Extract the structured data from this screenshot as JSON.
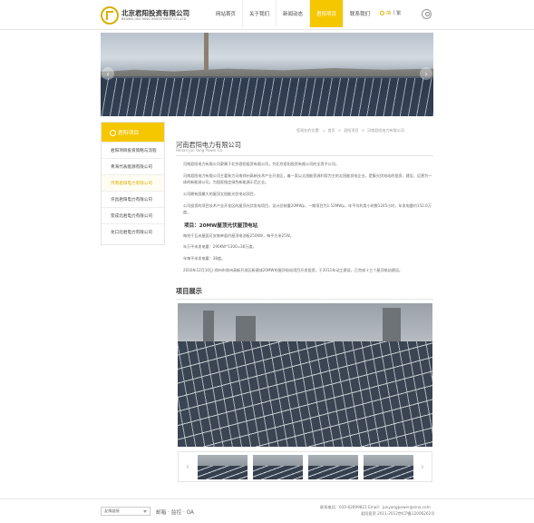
{
  "header": {
    "logo_cn": "北京君阳投资有限公司",
    "logo_en": "BEIJING JUN YANG INVESTMENT CO.,LTD",
    "nav": [
      "网站首页",
      "关于我们",
      "新闻动态",
      "君阳项目",
      "联系我们"
    ],
    "active_nav": "君阳项目",
    "lang_cn": "简",
    "lang_sep": "|",
    "lang_en": "繁",
    "accent_color": "#f5c700"
  },
  "sidebar": {
    "title": "君阳项目",
    "items": [
      "君阳项目投资策略与流程",
      "青海代表能源有限公司",
      "河南君阳电力有限公司",
      "许昌君阳电力有限公司",
      "荥成北君电力有限公司",
      "龙口北君电力有限公司"
    ],
    "active_index": 2
  },
  "breadcrumb": {
    "prefix": "您现在的位置:",
    "home": "首页",
    "sep1": ">",
    "level1": "君阳项目",
    "sep2": ">",
    "current": "河南君阳电力有限公司"
  },
  "article": {
    "title": "河南君阳电力有限公司",
    "subtitle": "Henan Jun Yang Power Co.",
    "p1": "河南君阳电力有限公司隶属于北京君阳投资有限公司，为北京君阳投资有限公司的全资子公司。",
    "p2": "河南君阳电力有限公司主要致力河南郑州高新技术产业开发区，着一家以太阳能资源利用为主的太阳能发电企业，是集光伏电站的投资、建设、运营为一体的新能源公司，为国家指定绿色新能源示范企业。",
    "p3": "公司拥有国最大的屋顶太阳能光伏电站项目。",
    "p4": "公司投资的项目技术产业开发区的屋顶光伏发电项目，设计总装量20MWp，一期项目为1.52MWp，年平均利用小时数1245小时，年发电量约152.6万度。",
    "section": "项目：20MW屋顶光伏屋顶电站",
    "p5": "每兆千瓦米屋面可安装单面约屋顶电池板250KW，每平方米25W。",
    "p6": "年万平米发电量：290KW*1300=38万度。",
    "p7": "年每平米发电量：38度。",
    "p8": "2010年12月10日-郑州市郑州高新开发区新建成20MW的屋顶电站项目开发投资，于2011年动工建设，已完成十三个屋顶电站建设。"
  },
  "project": {
    "title": "项目展示",
    "prev": "‹",
    "next": "›"
  },
  "footer": {
    "links_select": "友情链接",
    "links": "邮箱 · 监控 · OA",
    "contact": "联系电话：010-62699822      Email：junyangpower@sina.com",
    "copyright": "君阳投资 2011-2012京ICP备12006262号"
  }
}
